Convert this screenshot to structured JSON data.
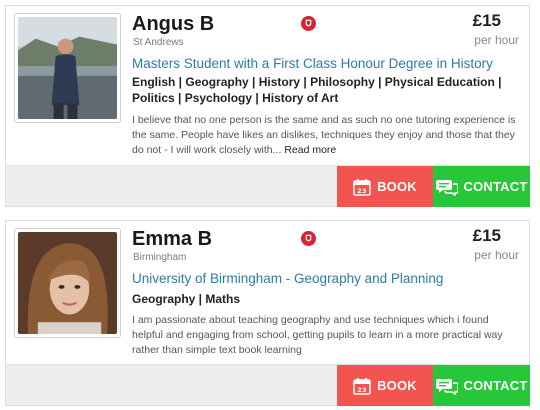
{
  "tutors": [
    {
      "name": "Angus B",
      "location": "St Andrews",
      "price": "£15",
      "per_hour": "per hour",
      "headline": "Masters Student with a First Class Honour Degree in History",
      "subjects": "English | Geography | History | Philosophy | Physical Education | Politics | Psychology | History of Art",
      "bio": "I believe that no one person is the same and as such no one tutoring experience is the same. People have likes an dislikes, techniques they enjoy and those that they do not - I will work closely with...",
      "read_more": "Read more",
      "book_label": "BOOK",
      "contact_label": "CONTACT"
    },
    {
      "name": "Emma B",
      "location": "Birmingham",
      "price": "£15",
      "per_hour": "per hour",
      "headline": "University of Birmingham - Geography and Planning",
      "subjects": "Geography | Maths",
      "bio": "I am passionate about teaching geography and use techniques which i found helpful and engaging from school, getting pupils to learn in a more practical way rather than simple text book learning",
      "book_label": "BOOK",
      "contact_label": "CONTACT"
    }
  ],
  "icons": {
    "university": "university-crest-icon",
    "calendar": "calendar-icon",
    "chat": "chat-bubble-icon"
  },
  "colors": {
    "headline": "#2d7ba8",
    "book": "#f2554f",
    "contact": "#28c739",
    "crest": "#d9232e",
    "action_bar": "#eeeeee"
  },
  "calendar_day": "23"
}
